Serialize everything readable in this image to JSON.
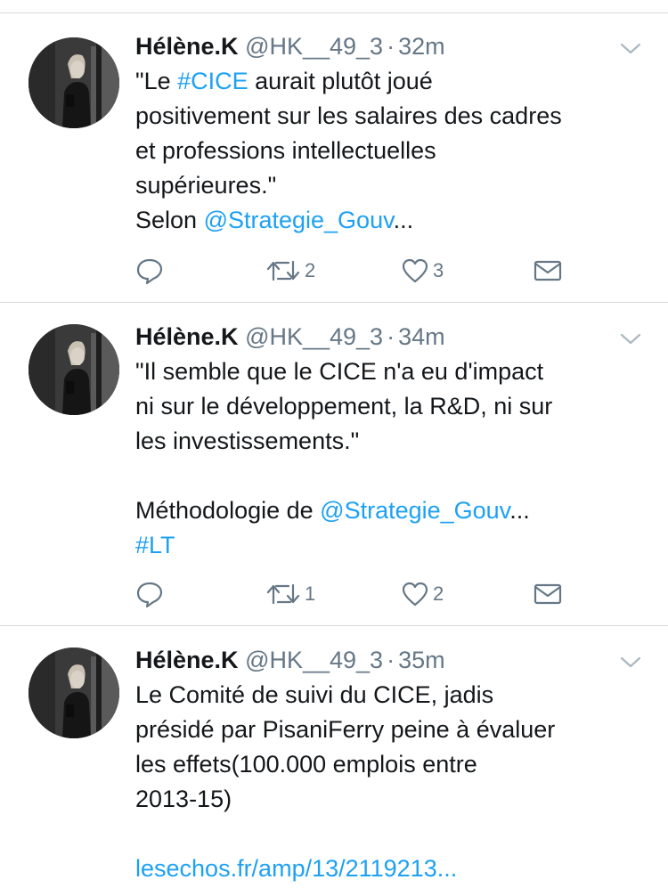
{
  "tweets": [
    {
      "name": "Hélène.K",
      "handle": "@HK__49_3",
      "separator": "·",
      "time": "32m",
      "lines": [
        [
          {
            "t": "\"Le "
          },
          {
            "t": "#CICE",
            "link": true
          },
          {
            "t": " aurait plutôt joué"
          }
        ],
        [
          {
            "t": "positivement sur les salaires des cadres"
          }
        ],
        [
          {
            "t": "et professions intellectuelles"
          }
        ],
        [
          {
            "t": "supérieures.\""
          }
        ],
        [
          {
            "t": "Selon "
          },
          {
            "t": "@Strategie_Gouv",
            "link": true
          },
          {
            "t": "..."
          }
        ]
      ],
      "retweet_count": "2",
      "like_count": "3"
    },
    {
      "name": "Hélène.K",
      "handle": "@HK__49_3",
      "separator": "·",
      "time": "34m",
      "lines": [
        [
          {
            "t": "\"Il semble que le CICE n'a eu d'impact"
          }
        ],
        [
          {
            "t": "ni sur le développement, la R&D, ni sur"
          }
        ],
        [
          {
            "t": "les investissements.\""
          }
        ],
        [],
        [
          {
            "t": "Méthodologie de "
          },
          {
            "t": "@Strategie_Gouv",
            "link": true
          },
          {
            "t": "..."
          }
        ],
        [
          {
            "t": "#LT",
            "link": true
          }
        ]
      ],
      "retweet_count": "1",
      "like_count": "2"
    },
    {
      "name": "Hélène.K",
      "handle": "@HK__49_3",
      "separator": "·",
      "time": "35m",
      "lines": [
        [
          {
            "t": "Le Comité de suivi du CICE, jadis"
          }
        ],
        [
          {
            "t": "présidé par PisaniFerry peine à évaluer"
          }
        ],
        [
          {
            "t": "les effets(100.000 emplois entre"
          }
        ],
        [
          {
            "t": "2013-15)"
          }
        ],
        [],
        [
          {
            "t": "lesechos.fr/amp/13/2119213...",
            "link": true
          }
        ]
      ],
      "retweet_count": "",
      "like_count": ""
    }
  ],
  "icons": {
    "reply": "reply-icon",
    "retweet": "retweet-icon",
    "like": "heart-icon",
    "message": "envelope-icon",
    "menu": "chevron-down-icon"
  },
  "colors": {
    "link": "#1da1f2",
    "secondary_text": "#657786",
    "divider": "#d6d9dc"
  }
}
